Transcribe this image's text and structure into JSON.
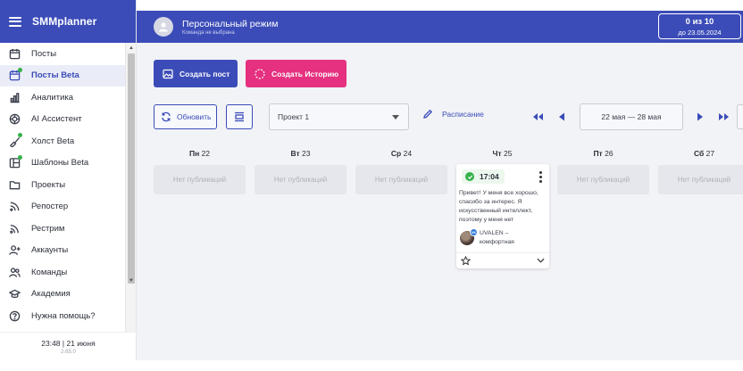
{
  "app": {
    "brand": "SMMplanner"
  },
  "sidebar": {
    "items": [
      {
        "label": "Посты",
        "icon": "calendar-icon",
        "active": false,
        "dot": false
      },
      {
        "label": "Посты Beta",
        "icon": "calendar-icon",
        "active": true,
        "dot": true
      },
      {
        "label": "Аналитика",
        "icon": "analytics-icon",
        "active": false,
        "dot": false
      },
      {
        "label": "AI Ассистент",
        "icon": "ai-icon",
        "active": false,
        "dot": false
      },
      {
        "label": "Холст Beta",
        "icon": "brush-icon",
        "active": false,
        "dot": true
      },
      {
        "label": "Шаблоны Beta",
        "icon": "templates-icon",
        "active": false,
        "dot": true
      },
      {
        "label": "Проекты",
        "icon": "folder-icon",
        "active": false,
        "dot": false
      },
      {
        "label": "Репостер",
        "icon": "rss-icon",
        "active": false,
        "dot": false
      },
      {
        "label": "Рестрим",
        "icon": "stream-icon",
        "active": false,
        "dot": false
      },
      {
        "label": "Аккаунты",
        "icon": "add-user-icon",
        "active": false,
        "dot": false
      },
      {
        "label": "Команды",
        "icon": "team-icon",
        "active": false,
        "dot": false
      },
      {
        "label": "Академия",
        "icon": "graduation-cap-icon",
        "active": false,
        "dot": false
      },
      {
        "label": "Нужна помощь?",
        "icon": "help-icon",
        "active": false,
        "dot": false
      }
    ],
    "footer": {
      "clock": "23:48  |  21 июня",
      "version": "2.65.0"
    }
  },
  "topbar": {
    "mode_title": "Персональный режим",
    "mode_subtitle": "Команда не выбрана",
    "quota_main": "0 из 10",
    "quota_sub": "до 23.05.2024"
  },
  "toolbar": {
    "create_post": "Создать пост",
    "create_story": "Создать Историю",
    "refresh": "Обновить",
    "project": "Проект 1",
    "schedule": "Расписание",
    "date_range": "22 мая — 28 мая"
  },
  "calendar": {
    "days": [
      {
        "weekday": "Пн",
        "date": "22"
      },
      {
        "weekday": "Вт",
        "date": "23"
      },
      {
        "weekday": "Ср",
        "date": "24"
      },
      {
        "weekday": "Чт",
        "date": "25"
      },
      {
        "weekday": "Пт",
        "date": "26"
      },
      {
        "weekday": "Сб",
        "date": "27"
      }
    ],
    "empty_label": "Нет публикаций",
    "post": {
      "time": "17:04",
      "text": "Привет! У меня все хорошо, спасибо за интерес. Я искусственный интеллект, поэтому у меня нет",
      "account": "UVALEN – комфортная",
      "network_badge": "VK"
    }
  },
  "colors": {
    "brand": "#3b4cb8",
    "story": "#e5317f",
    "success": "#35b24a"
  }
}
